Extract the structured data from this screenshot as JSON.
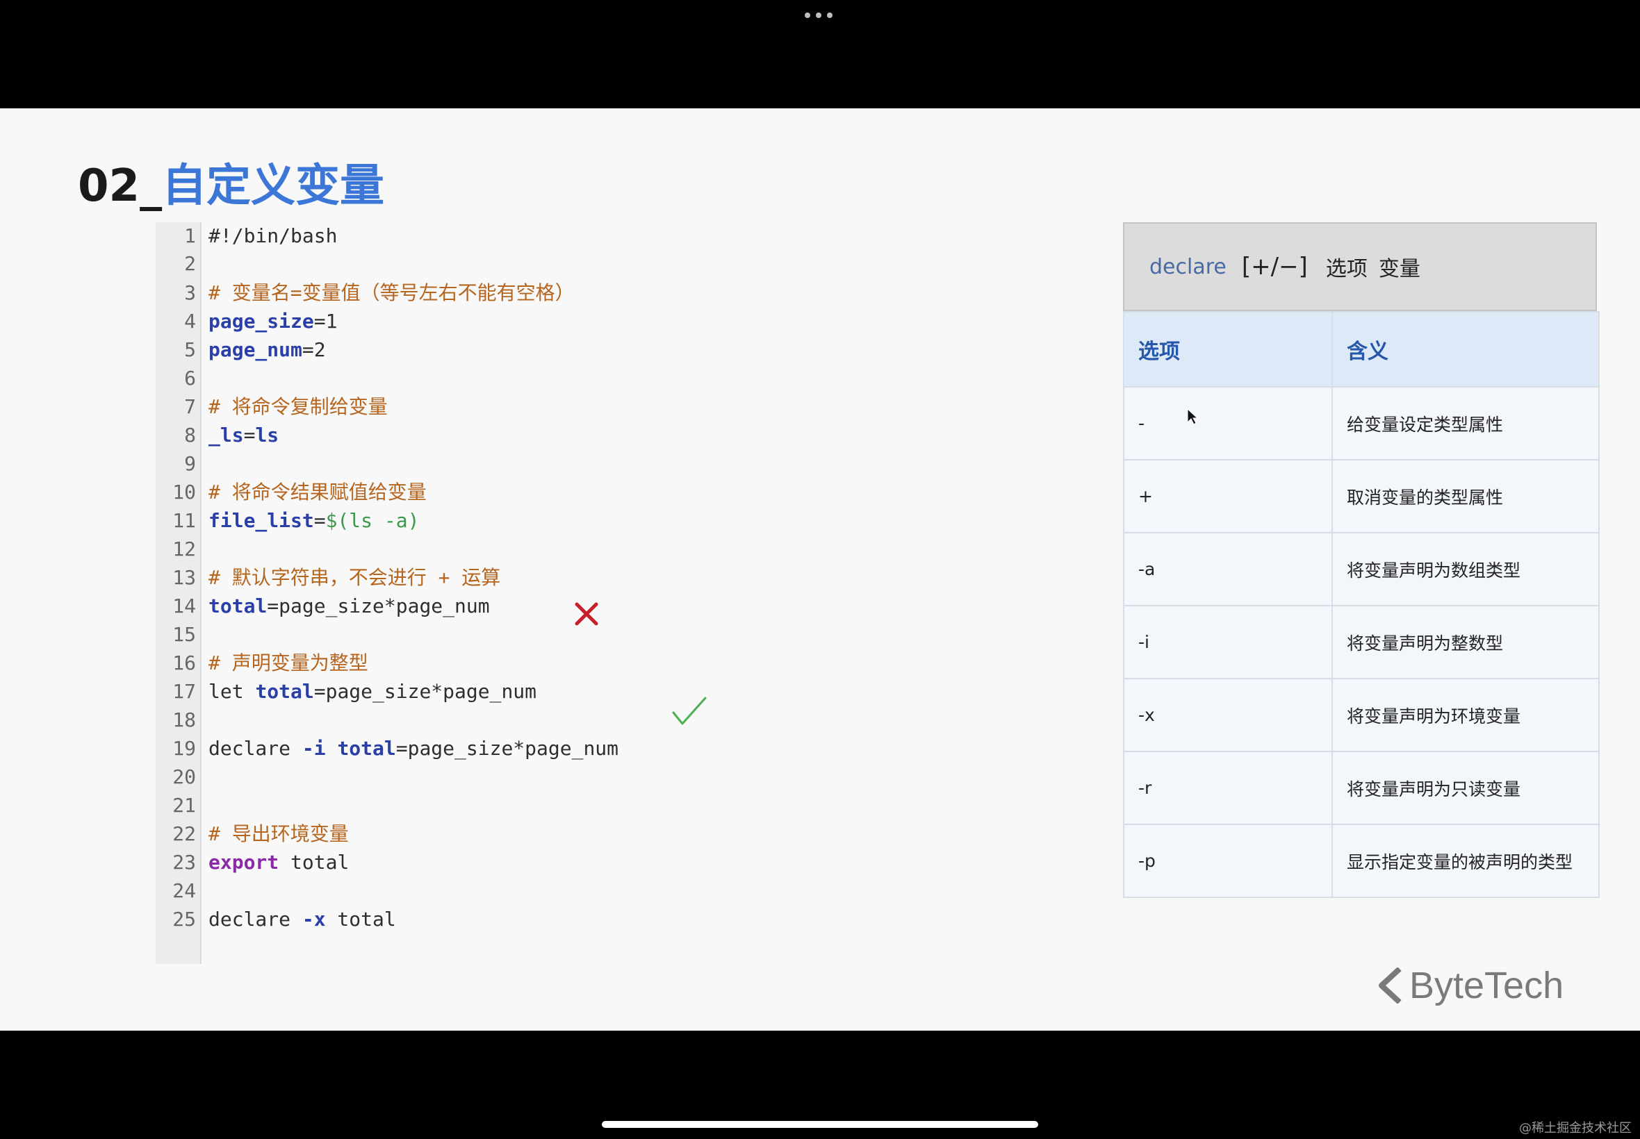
{
  "title": {
    "number": "02_",
    "text": "自定义变量"
  },
  "code_lines": [
    {
      "n": "1",
      "parts": [
        {
          "t": "#!/bin/bash",
          "c": ""
        }
      ]
    },
    {
      "n": "2",
      "parts": []
    },
    {
      "n": "3",
      "parts": [
        {
          "t": "# 变量名=变量值（等号左右不能有空格）",
          "c": "cmt"
        }
      ]
    },
    {
      "n": "4",
      "parts": [
        {
          "t": "page_size",
          "c": "var"
        },
        {
          "t": "=1",
          "c": ""
        }
      ]
    },
    {
      "n": "5",
      "parts": [
        {
          "t": "page_num",
          "c": "var"
        },
        {
          "t": "=2",
          "c": ""
        }
      ]
    },
    {
      "n": "6",
      "parts": []
    },
    {
      "n": "7",
      "parts": [
        {
          "t": "# 将命令复制给变量",
          "c": "cmt"
        }
      ]
    },
    {
      "n": "8",
      "parts": [
        {
          "t": "_ls",
          "c": "var"
        },
        {
          "t": "=",
          "c": ""
        },
        {
          "t": "ls",
          "c": "var"
        }
      ]
    },
    {
      "n": "9",
      "parts": []
    },
    {
      "n": "10",
      "parts": [
        {
          "t": "# 将命令结果赋值给变量",
          "c": "cmt"
        }
      ]
    },
    {
      "n": "11",
      "parts": [
        {
          "t": "file_list",
          "c": "var"
        },
        {
          "t": "=",
          "c": ""
        },
        {
          "t": "$(ls -a)",
          "c": "str"
        }
      ]
    },
    {
      "n": "12",
      "parts": []
    },
    {
      "n": "13",
      "parts": [
        {
          "t": "# 默认字符串，不会进行 + 运算",
          "c": "cmt"
        }
      ]
    },
    {
      "n": "14",
      "parts": [
        {
          "t": "total",
          "c": "var"
        },
        {
          "t": "=page_size*page_num",
          "c": ""
        }
      ]
    },
    {
      "n": "15",
      "parts": []
    },
    {
      "n": "16",
      "parts": [
        {
          "t": "# 声明变量为整型",
          "c": "cmt"
        }
      ]
    },
    {
      "n": "17",
      "parts": [
        {
          "t": "let ",
          "c": ""
        },
        {
          "t": "total",
          "c": "var"
        },
        {
          "t": "=page_size*page_num",
          "c": ""
        }
      ]
    },
    {
      "n": "18",
      "parts": []
    },
    {
      "n": "19",
      "parts": [
        {
          "t": "declare ",
          "c": ""
        },
        {
          "t": "-i ",
          "c": "flag"
        },
        {
          "t": "total",
          "c": "var"
        },
        {
          "t": "=page_size*page_num",
          "c": ""
        }
      ]
    },
    {
      "n": "20",
      "parts": []
    },
    {
      "n": "21",
      "parts": []
    },
    {
      "n": "22",
      "parts": [
        {
          "t": "# 导出环境变量",
          "c": "cmt"
        }
      ]
    },
    {
      "n": "23",
      "parts": [
        {
          "t": "export",
          "c": "kw"
        },
        {
          "t": " total",
          "c": ""
        }
      ]
    },
    {
      "n": "24",
      "parts": []
    },
    {
      "n": "25",
      "parts": [
        {
          "t": "declare ",
          "c": ""
        },
        {
          "t": "-x",
          "c": "flag"
        },
        {
          "t": " total",
          "c": ""
        }
      ]
    }
  ],
  "declare_syntax": {
    "command": "declare",
    "sign": "[+/−]",
    "option": "选项",
    "variable": "变量"
  },
  "options_table": {
    "headers": [
      "选项",
      "含义"
    ],
    "rows": [
      {
        "opt": "-",
        "meaning": "给变量设定类型属性"
      },
      {
        "opt": "+",
        "meaning": "取消变量的类型属性"
      },
      {
        "opt": "-a",
        "meaning": "将变量声明为数组类型"
      },
      {
        "opt": "-i",
        "meaning": "将变量声明为整数型"
      },
      {
        "opt": "-x",
        "meaning": "将变量声明为环境变量"
      },
      {
        "opt": "-r",
        "meaning": "将变量声明为只读变量"
      },
      {
        "opt": "-p",
        "meaning": "显示指定变量的被声明的类型"
      }
    ]
  },
  "marks": {
    "wrong_color": "#c8202a",
    "right_color": "#4caf50"
  },
  "logo": {
    "text": "ByteTech"
  },
  "watermark": "@稀土掘金技术社区"
}
